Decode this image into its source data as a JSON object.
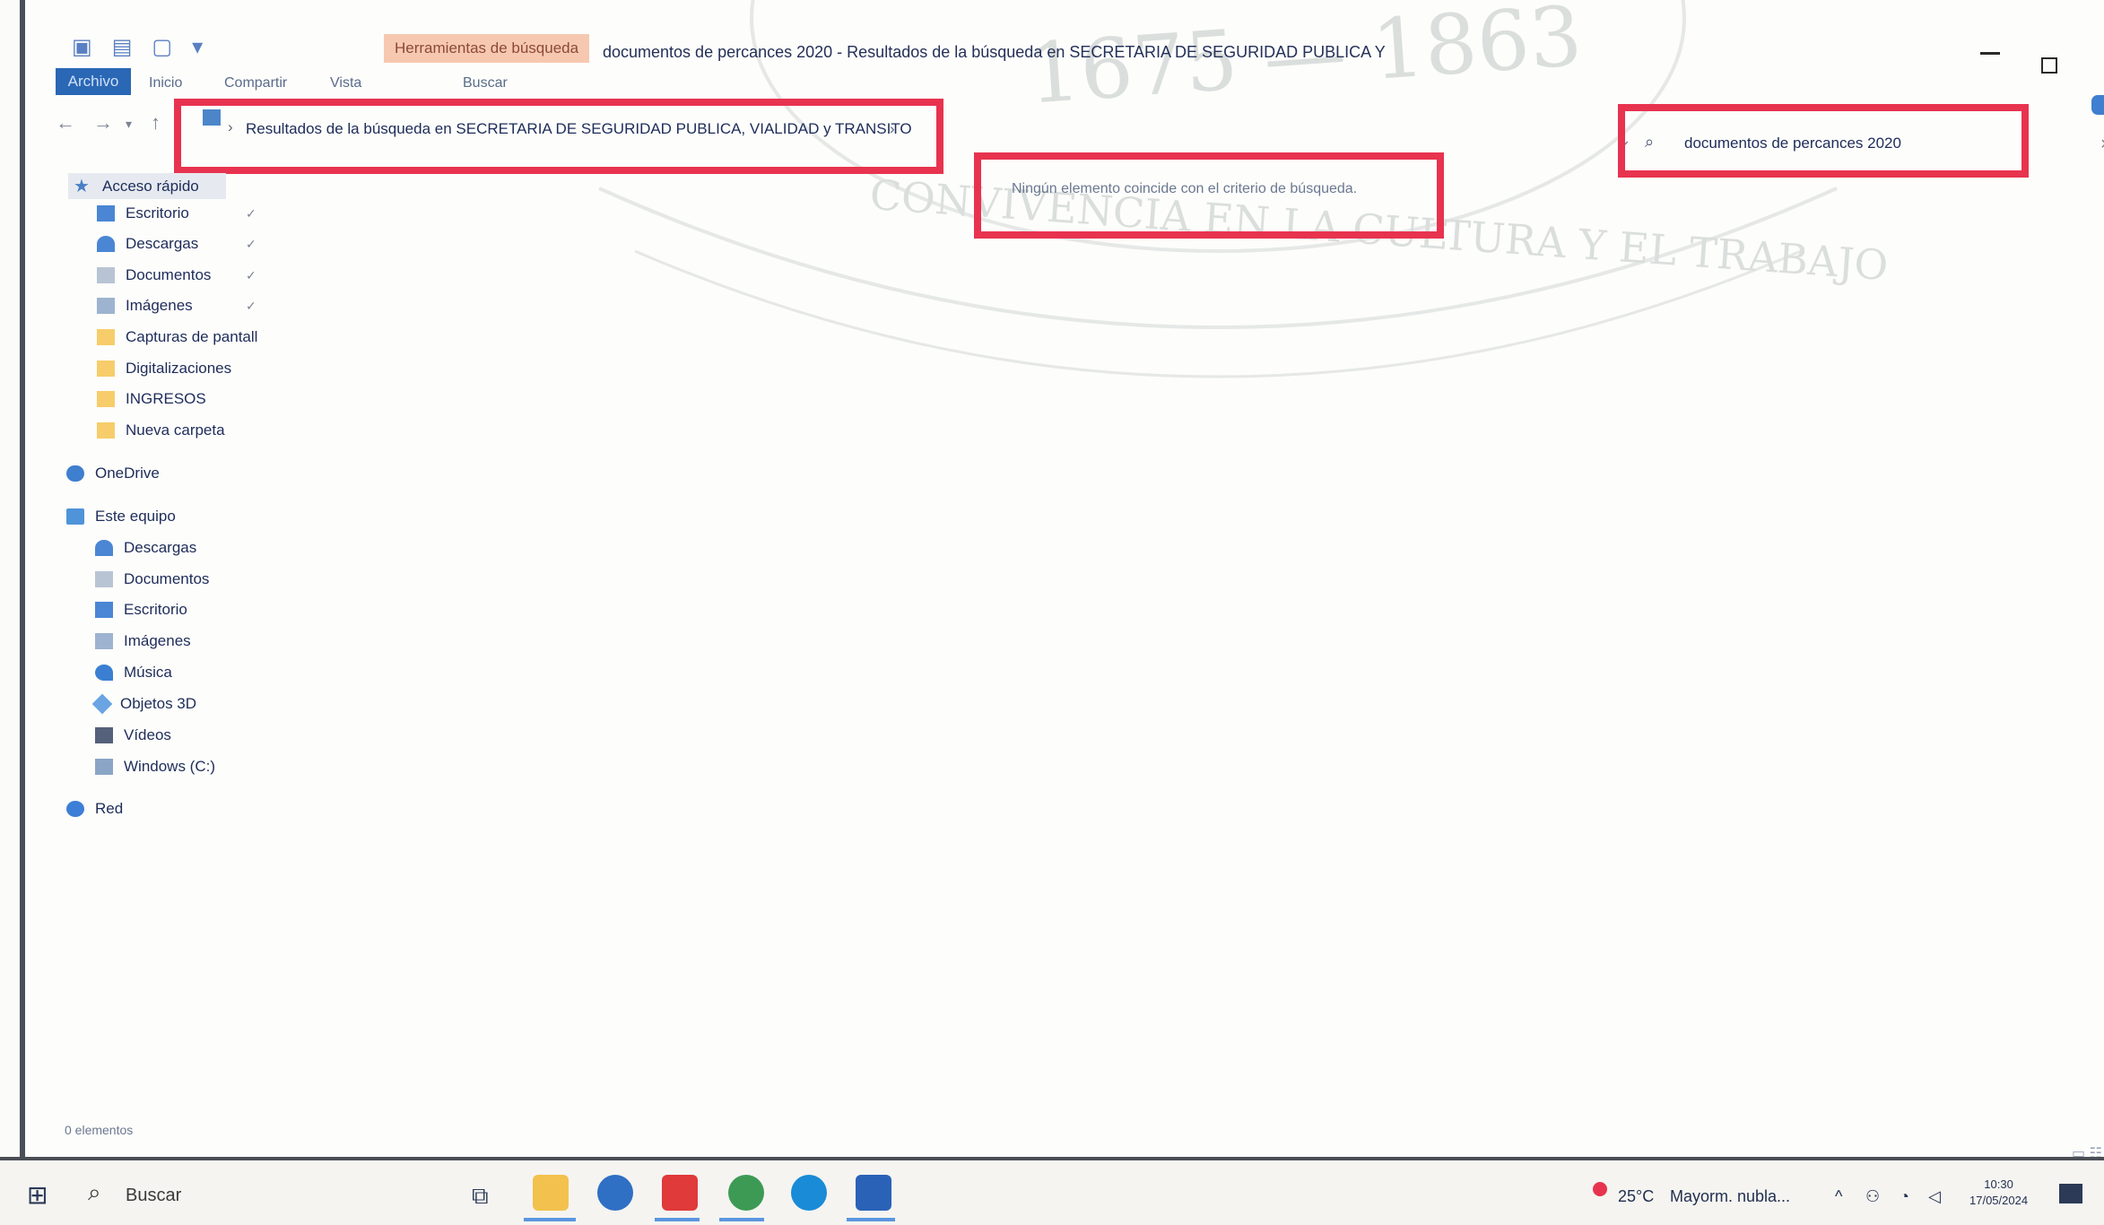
{
  "window": {
    "context_tab": "Herramientas de búsqueda",
    "title": "documentos de percances 2020 - Resultados de la búsqueda en SECRETARIA DE SEGURIDAD PUBLICA Y",
    "controls": {
      "minimize": "—",
      "maximize": "☐",
      "close": "✕"
    }
  },
  "ribbon": {
    "file_tab": "Archivo",
    "tabs": [
      "Inicio",
      "Compartir",
      "Vista",
      "Buscar"
    ]
  },
  "address_bar": {
    "breadcrumb": "Resultados de la búsqueda en SECRETARIA DE SEGURIDAD PUBLICA, VIALIDAD y TRANSITO",
    "separator": "›"
  },
  "search": {
    "value": "documentos de percances 2020"
  },
  "results": {
    "message": "Ningún elemento coincide con el criterio de búsqueda."
  },
  "watermark": {
    "years": "1675 — 1863",
    "motto": "CONVIVENCIA EN LA CULTURA Y EL TRABAJO"
  },
  "nav_pane": {
    "quick_access": "Acceso rápido",
    "quick_items": [
      {
        "label": "Escritorio",
        "icon": "desktop-icon"
      },
      {
        "label": "Descargas",
        "icon": "download-icon"
      },
      {
        "label": "Documentos",
        "icon": "documents-icon"
      },
      {
        "label": "Imágenes",
        "icon": "pictures-icon"
      },
      {
        "label": "Capturas de pantall",
        "icon": "folder-icon"
      },
      {
        "label": "Digitalizaciones",
        "icon": "folder-icon"
      },
      {
        "label": "INGRESOS",
        "icon": "folder-icon"
      },
      {
        "label": "Nueva carpeta",
        "icon": "folder-icon"
      }
    ],
    "onedrive": "OneDrive",
    "this_pc": "Este equipo",
    "pc_items": [
      {
        "label": "Descargas",
        "icon": "download-icon"
      },
      {
        "label": "Documentos",
        "icon": "documents-icon"
      },
      {
        "label": "Escritorio",
        "icon": "desktop-icon"
      },
      {
        "label": "Imágenes",
        "icon": "pictures-icon"
      },
      {
        "label": "Música",
        "icon": "music-icon"
      },
      {
        "label": "Objetos 3D",
        "icon": "objects-3d-icon"
      },
      {
        "label": "Vídeos",
        "icon": "videos-icon"
      },
      {
        "label": "Windows (C:)",
        "icon": "drive-icon"
      }
    ],
    "network": "Red"
  },
  "status_bar": {
    "items_count": "0 elementos"
  },
  "taskbar": {
    "search_label": "Buscar",
    "weather_temp": "25°C",
    "weather_text": "Mayorm. nubla...",
    "time": "10:30",
    "date": "17/05/2024",
    "app_colors": [
      "#f2c14e",
      "#2f6fc4",
      "#e03a3a",
      "#3d9a55",
      "#1a8bd6",
      "#2a62b8"
    ]
  }
}
